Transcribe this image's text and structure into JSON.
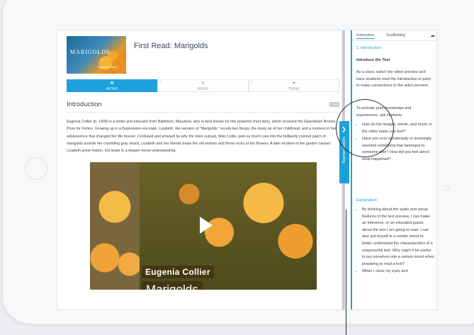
{
  "lesson": {
    "thumbnail_title": "MARIGOLDS",
    "thumbnail_sub": "Eugenia Collier",
    "title": "First Read: Marigolds"
  },
  "steps": [
    {
      "num": "1",
      "icon": "⌘",
      "label": "INTRO",
      "active": true
    },
    {
      "num": "2",
      "icon": "≡",
      "label": "READ",
      "active": false
    },
    {
      "num": "3",
      "icon": "☀",
      "label": "THINK",
      "active": false
    }
  ],
  "section": {
    "title": "Introduction",
    "audio_label": "AUDIO"
  },
  "intro_text": "Eugenia Collier (b. 1928) is a writer and educator from Baltimore, Maryland, who is best known for this powerful short story, which received the Gwendolyn Brooks Prize for Fiction. Growing up in a Depression-era town, Lizabeth, the narrator of “Marigolds,” recalls two things: the dusty air of her childhood, and a moment in her adolescence that changed her life forever. Confused and amused by why the town outcast, Miss Lottie, puts so much care into the brilliantly colored patch of marigolds outside her crumbling gray shack, Lizabeth and her friends tease the old woman and throw rocks at her flowers. A later incident in the garden causes Lizabeth great shame, but leads to a deeper moral understanding.",
  "video": {
    "caption_author": "Eugenia Collier",
    "caption_title": "Marigolds"
  },
  "teacher_tab": {
    "label": "Teacher Edition",
    "chevron": "❯"
  },
  "panel": {
    "tabs": [
      "Instruction",
      "Scaffolding"
    ],
    "cloud_icon": "☁",
    "section": "1. Introduction",
    "subheading": "Introduce the Text",
    "para1": "As a class, watch the video preview and have students read the introduction in pairs to make connections to the video preview.",
    "para2": "To activate prior knowledge and experiences, ask students:",
    "questions": [
      "How do the images, words, and music in the video make you feel?",
      "Have you ever accidentally or knowingly wrecked something that belonged to someone else? How did you feel about what happened?"
    ],
    "explanation_label": "Explanation:",
    "explanations": [
      "By thinking about the audio and visual features of the text preview, I can make an inference, or an educated guess, about the text I am going to read. I can also put myself in a certain mood to better understand the characteristics of a suspenseful text. Why might it be useful to put ourselves into a certain mood when preparing to read a text?",
      "When I close my eyes and"
    ]
  },
  "colors": {
    "accent": "#1ea0dc",
    "text": "#3a424c"
  }
}
